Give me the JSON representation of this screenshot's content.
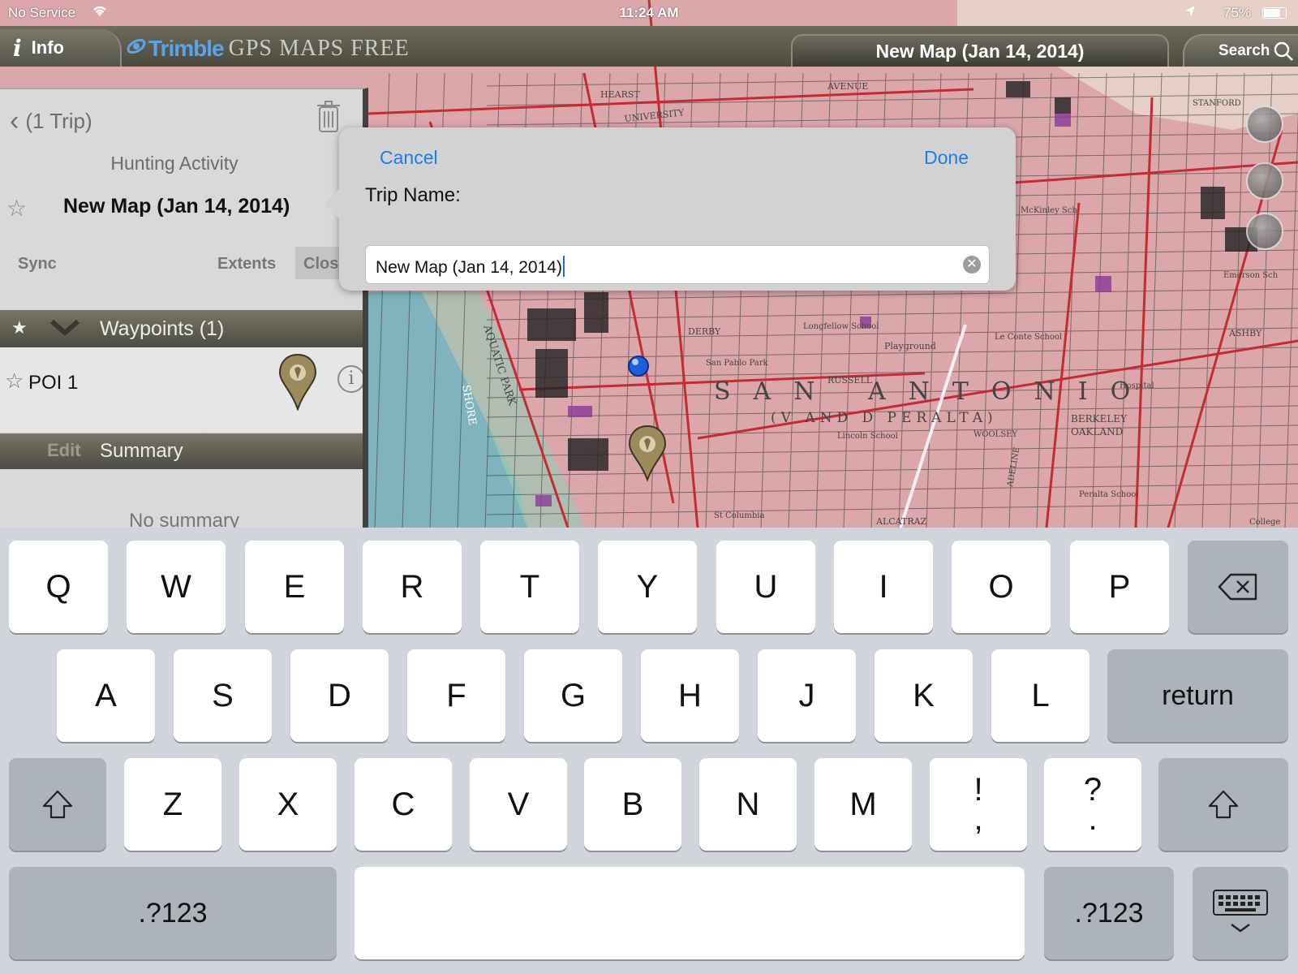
{
  "status_bar": {
    "carrier": "No Service",
    "time": "11:24 AM",
    "battery_percent": "75%",
    "battery_level": 0.75,
    "icons": [
      "wifi-icon",
      "location-arrow-icon",
      "battery-icon"
    ]
  },
  "toolbar": {
    "info_icon": "i",
    "info_label": "Info",
    "brand": "Trimble",
    "app_name": "GPS MAPS FREE",
    "map_title": "New Map (Jan 14, 2014)",
    "search_label": "Search"
  },
  "panel": {
    "back_label": "(1 Trip)",
    "activity": "Hunting Activity",
    "map_name": "New Map (Jan 14, 2014)",
    "actions": {
      "sync": "Sync",
      "extents": "Extents",
      "close": "Close"
    },
    "waypoints_header": "Waypoints (1)",
    "waypoints": [
      {
        "name": "POI 1"
      }
    ],
    "summary_edit": "Edit",
    "summary_header": "Summary",
    "summary_text": "No summary"
  },
  "popover": {
    "cancel_label": "Cancel",
    "done_label": "Done",
    "field_label": "Trip Name:",
    "field_value": "New Map (Jan 14, 2014)"
  },
  "map": {
    "labels": [
      "SAN ANTONIO",
      "(V AND D PERALTA)",
      "AQUATIC PARK",
      "SHORE",
      "AVENUE",
      "UNIVERSITY",
      "HEARST",
      "RUSSELL",
      "ASHBY",
      "DERBY",
      "Playground",
      "Lincoln School",
      "Le Conte School",
      "Longfellow School",
      "San Pablo Park",
      "Emerson Sch",
      "McKinley Sch",
      "BERKELEY",
      "OAKLAND",
      "ALCATRAZ",
      "St Columbia",
      "College",
      "Peralta School",
      "Hospital",
      "WOOLSEY",
      "ADELINE",
      "STANFORD"
    ]
  },
  "keyboard": {
    "row1": [
      "Q",
      "W",
      "E",
      "R",
      "T",
      "Y",
      "U",
      "I",
      "O",
      "P"
    ],
    "row2": [
      "A",
      "S",
      "D",
      "F",
      "G",
      "H",
      "J",
      "K",
      "L"
    ],
    "return_label": "return",
    "row3": [
      "Z",
      "X",
      "C",
      "V",
      "B",
      "N",
      "M"
    ],
    "punct1": [
      "!",
      ","
    ],
    "punct2": [
      "?",
      "."
    ],
    "numbers_label": ".?123"
  },
  "colors": {
    "map_urban": "#dba7ab",
    "map_water": "#7fb4bd",
    "road_red": "#c42b34",
    "ios_blue": "#1b7ee8",
    "toolbar_olive": "#5e5d50",
    "keyboard_bg": "#d1d5db"
  }
}
